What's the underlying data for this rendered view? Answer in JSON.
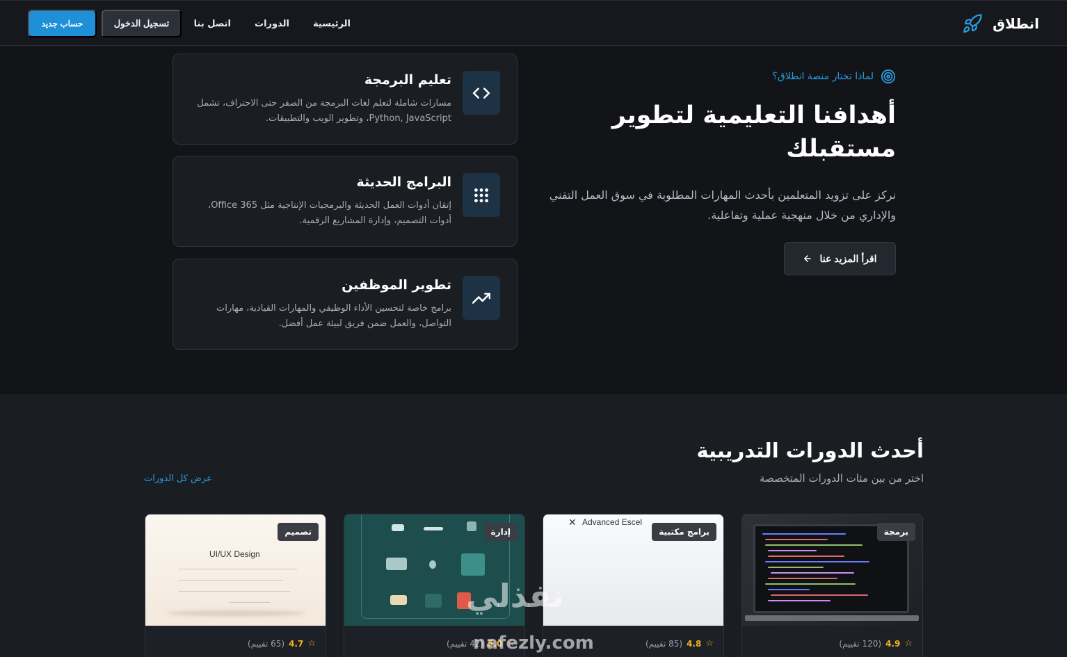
{
  "nav": {
    "brand": "انطلاق",
    "brand_icon": "rocket-icon",
    "links": [
      "الرئيسية",
      "الدورات",
      "اتصل بنا"
    ],
    "login": "تسجيل الدخول",
    "signup": "حساب جديد"
  },
  "hero": {
    "why_label": "لماذا تختار منصة انطلاق؟",
    "why_icon": "target-icon",
    "title": "أهدافنا التعليمية لتطوير مستقبلك",
    "text": "نركز على تزويد المتعلمين بأحدث المهارات المطلوبة في سوق العمل التقني والإداري من خلال منهجية عملية وتفاعلية.",
    "more_button": "اقرأ المزيد عنا",
    "more_icon": "arrow-left-icon"
  },
  "features": [
    {
      "title": "تعليم البرمجة",
      "desc": "مسارات شاملة لتعلم لغات البرمجة من الصفر حتى الاحتراف، تشمل Python, JavaScript، وتطوير الويب والتطبيقات.",
      "icon": "code-icon"
    },
    {
      "title": "البرامج الحديثة",
      "desc": "إتقان أدوات العمل الحديثة والبرمجيات الإنتاجية مثل Office 365، أدوات التصميم، وإدارة المشاريع الرقمية.",
      "icon": "grid-icon"
    },
    {
      "title": "تطوير الموظفين",
      "desc": "برامج خاصة لتحسين الأداء الوظيفي والمهارات القيادية، مهارات التواصل، والعمل ضمن فريق لبيئة عمل أفضل.",
      "icon": "trending-up-icon"
    }
  ],
  "courses": {
    "title": "أحدث الدورات التدريبية",
    "subtitle": "اختر من بين مئات الدورات المتخصصة",
    "view_all": "عرض كل الدورات",
    "items": [
      {
        "badge": "برمجة",
        "rating": "4.9",
        "count": "(120 تقييم)"
      },
      {
        "badge": "برامج مكتبية",
        "rating": "4.8",
        "count": "(85 تقييم)",
        "thumb_title": "Advanced Escel"
      },
      {
        "badge": "إدارة",
        "rating": "5.0",
        "count": "(42 تقييم)"
      },
      {
        "badge": "تصميم",
        "rating": "4.7",
        "count": "(65 تقييم)",
        "thumb_title": "UI/UX Design"
      }
    ]
  },
  "watermark": {
    "logo": "نفذلي",
    "domain": "nafezly.com"
  },
  "colors": {
    "accent": "#1e90d8",
    "link": "#2b9be0",
    "star": "#f3b21e",
    "bg": "#121418"
  }
}
